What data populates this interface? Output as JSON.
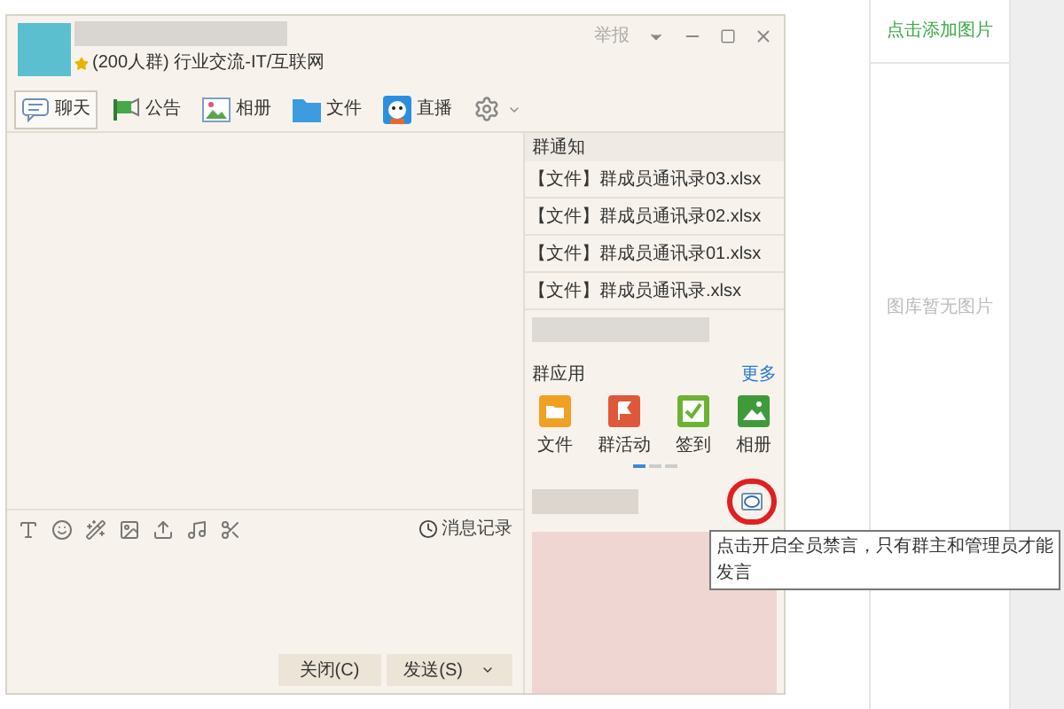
{
  "window": {
    "group_info": "(200人群) 行业交流-IT/互联网",
    "report": "举报"
  },
  "tabs": [
    {
      "label": "聊天",
      "selected": true,
      "kind": "chat"
    },
    {
      "label": "公告",
      "selected": false,
      "kind": "notice"
    },
    {
      "label": "相册",
      "selected": false,
      "kind": "album"
    },
    {
      "label": "文件",
      "selected": false,
      "kind": "file"
    },
    {
      "label": "直播",
      "selected": false,
      "kind": "live"
    }
  ],
  "input_toolbar": {
    "history": "消息记录"
  },
  "buttons": {
    "close": "关闭(C)",
    "send": "发送(S)"
  },
  "notice_panel": {
    "title": "群通知",
    "items": [
      "【文件】群成员通讯录03.xlsx",
      "【文件】群成员通讯录02.xlsx",
      "【文件】群成员通讯录01.xlsx",
      "【文件】群成员通讯录.xlsx"
    ]
  },
  "apps": {
    "title": "群应用",
    "more": "更多",
    "items": [
      {
        "label": "文件",
        "kind": "folder"
      },
      {
        "label": "群活动",
        "kind": "activity"
      },
      {
        "label": "签到",
        "kind": "checkin"
      },
      {
        "label": "相册",
        "kind": "album"
      }
    ],
    "pages": [
      {
        "selected": true
      },
      {
        "selected": false
      },
      {
        "selected": false
      }
    ]
  },
  "tooltip": "点击开启全员禁言，只有群主和管理员才能发言",
  "gallery": {
    "add": "点击添加图片",
    "empty": "图库暂无图片"
  }
}
